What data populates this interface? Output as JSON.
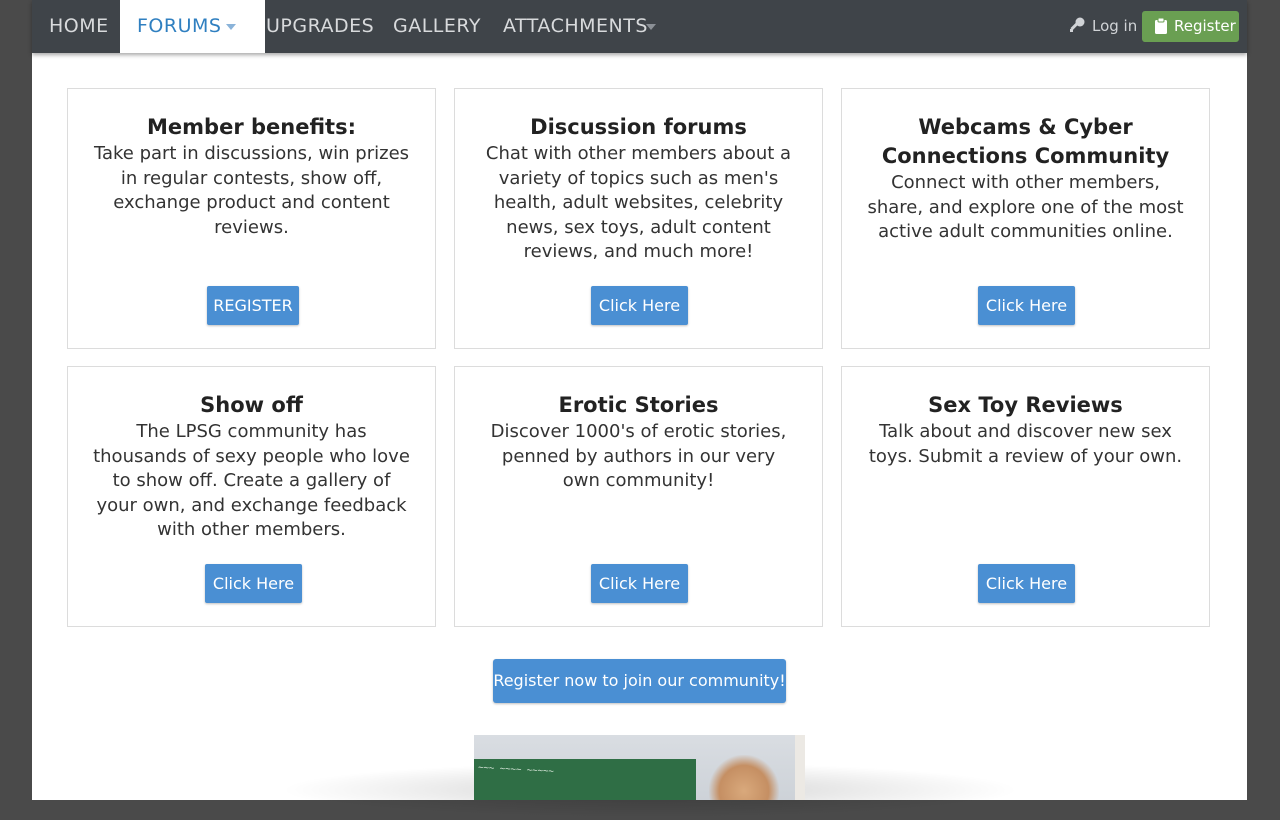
{
  "nav": {
    "home": "HOME",
    "forums": "FORUMS",
    "upgrades": "UPGRADES",
    "gallery": "GALLERY",
    "attachments": "ATTACHMENTS",
    "login": "Log in",
    "register": "Register"
  },
  "cards": [
    {
      "title": "Member benefits:",
      "text": "Take part in discussions, win prizes in regular contests, show off, exchange product and content reviews.",
      "button": "REGISTER"
    },
    {
      "title": "Discussion forums",
      "text": "Chat with other members about a variety of topics such as men's health, adult websites, celebrity news, sex toys, adult content reviews, and much more!",
      "button": "Click Here"
    },
    {
      "title": "Webcams & Cyber Connections Community",
      "text": "Connect with other members, share, and explore one of the most active adult communities online.",
      "button": "Click Here"
    },
    {
      "title": "Show off",
      "text": "The LPSG community has thousands of sexy people who love to show off. Create a gallery of your own, and exchange feedback with other members.",
      "button": "Click Here"
    },
    {
      "title": "Erotic Stories",
      "text": "Discover 1000's of erotic stories, penned by authors in our very own community!",
      "button": "Click Here"
    },
    {
      "title": "Sex Toy Reviews",
      "text": "Talk about and discover new sex toys. Submit a review of your own.",
      "button": "Click Here"
    }
  ],
  "cta": "Register now to join our community!",
  "colors": {
    "nav_bg": "#3f4449",
    "active_tab_text": "#2f7fc0",
    "button_blue": "#4a8fd3",
    "register_green": "#6a9f52"
  }
}
